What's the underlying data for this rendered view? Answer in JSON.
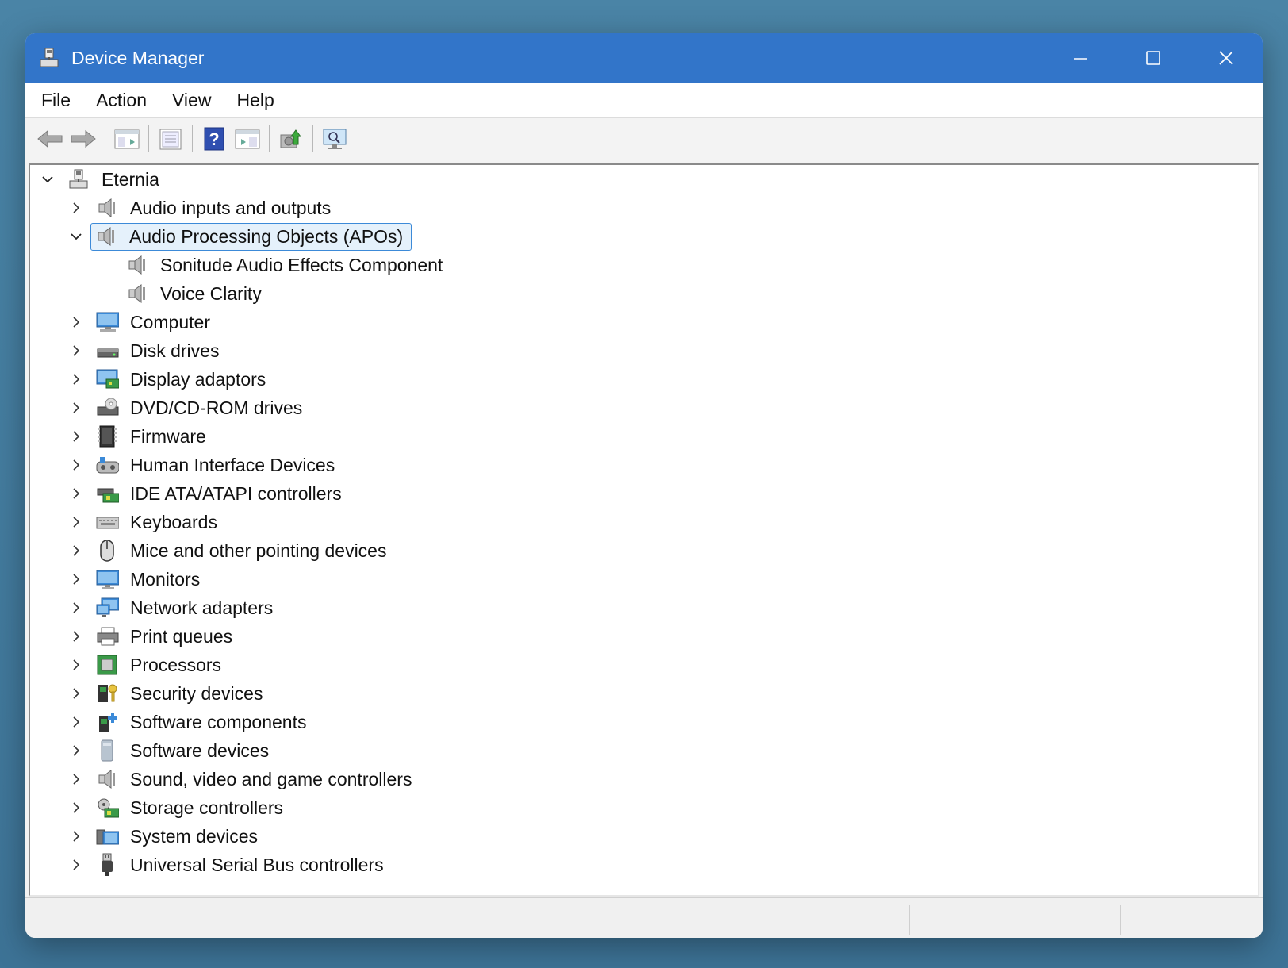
{
  "window": {
    "title": "Device Manager",
    "icon": "device-manager-icon"
  },
  "menu": [
    "File",
    "Action",
    "View",
    "Help"
  ],
  "toolbar": {
    "buttons": [
      "back-icon",
      "forward-icon",
      "show-hide-console-tree-icon",
      "properties-icon",
      "help-icon",
      "view-action-pane-icon",
      "update-driver-icon",
      "scan-hardware-icon"
    ]
  },
  "tree": {
    "root": "Eternia",
    "items": [
      {
        "label": "Audio inputs and outputs",
        "icon": "speaker-icon",
        "expanded": false
      },
      {
        "label": "Audio Processing Objects (APOs)",
        "icon": "speaker-icon",
        "expanded": true,
        "selected": true,
        "children": [
          "Sonitude Audio Effects Component",
          "Voice Clarity"
        ]
      },
      {
        "label": "Computer",
        "icon": "computer-icon",
        "expanded": false
      },
      {
        "label": "Disk drives",
        "icon": "disk-drive-icon",
        "expanded": false
      },
      {
        "label": "Display adaptors",
        "icon": "display-adapter-icon",
        "expanded": false
      },
      {
        "label": "DVD/CD-ROM drives",
        "icon": "dvd-drive-icon",
        "expanded": false
      },
      {
        "label": "Firmware",
        "icon": "firmware-icon",
        "expanded": false
      },
      {
        "label": "Human Interface Devices",
        "icon": "hid-icon",
        "expanded": false
      },
      {
        "label": "IDE ATA/ATAPI controllers",
        "icon": "ide-controller-icon",
        "expanded": false
      },
      {
        "label": "Keyboards",
        "icon": "keyboard-icon",
        "expanded": false
      },
      {
        "label": "Mice and other pointing devices",
        "icon": "mouse-icon",
        "expanded": false
      },
      {
        "label": "Monitors",
        "icon": "monitor-icon",
        "expanded": false
      },
      {
        "label": "Network adapters",
        "icon": "network-adapter-icon",
        "expanded": false
      },
      {
        "label": "Print queues",
        "icon": "printer-icon",
        "expanded": false
      },
      {
        "label": "Processors",
        "icon": "processor-icon",
        "expanded": false
      },
      {
        "label": "Security devices",
        "icon": "security-device-icon",
        "expanded": false
      },
      {
        "label": "Software components",
        "icon": "software-component-icon",
        "expanded": false
      },
      {
        "label": "Software devices",
        "icon": "software-device-icon",
        "expanded": false
      },
      {
        "label": "Sound, video and game controllers",
        "icon": "speaker-icon",
        "expanded": false
      },
      {
        "label": "Storage controllers",
        "icon": "storage-controller-icon",
        "expanded": false
      },
      {
        "label": "System devices",
        "icon": "system-device-icon",
        "expanded": false
      },
      {
        "label": "Universal Serial Bus controllers",
        "icon": "usb-icon",
        "expanded": false
      }
    ]
  },
  "colors": {
    "titlebar": "#3275c9",
    "selection_bg": "#e5f1fb",
    "selection_border": "#3c8ad8"
  }
}
